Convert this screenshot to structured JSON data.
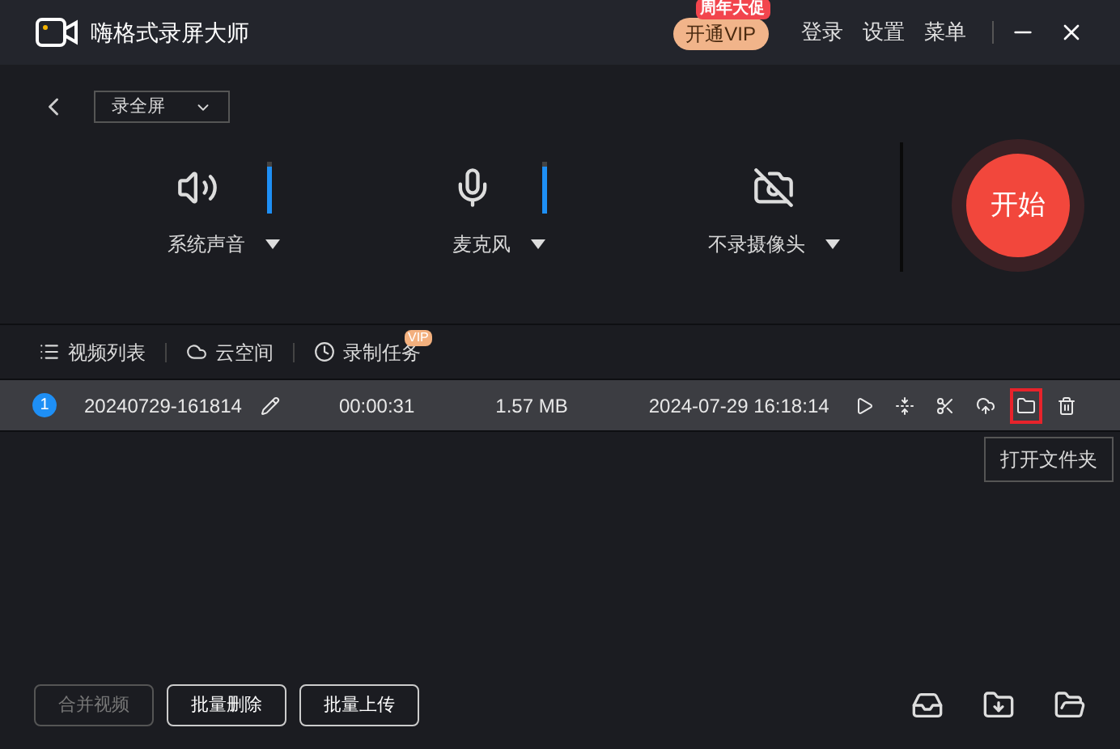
{
  "window": {
    "title": "嗨格式录屏大师",
    "promo_badge": "周年大促",
    "vip_button": "开通VIP",
    "menu": [
      "登录",
      "设置",
      "菜单"
    ]
  },
  "mode_select": {
    "value": "录全屏"
  },
  "sources": [
    {
      "kind": "speaker",
      "label": "系统声音",
      "level": 0.9
    },
    {
      "kind": "mic",
      "label": "麦克风",
      "level": 0.9
    },
    {
      "kind": "camera",
      "label": "不录摄像头"
    }
  ],
  "start_button": "开始",
  "tabs": [
    {
      "kind": "list",
      "label": "视频列表"
    },
    {
      "kind": "cloud",
      "label": "云空间"
    },
    {
      "kind": "clock",
      "label": "录制任务",
      "badge": "VIP"
    }
  ],
  "recordings": [
    {
      "index": "1",
      "name": "20240729-161814",
      "duration": "00:00:31",
      "size": "1.57 MB",
      "date": "2024-07-29 16:18:14",
      "actions": [
        {
          "kind": "play",
          "highlighted": false
        },
        {
          "kind": "compress",
          "highlighted": false
        },
        {
          "kind": "cut",
          "highlighted": false
        },
        {
          "kind": "upload",
          "highlighted": false
        },
        {
          "kind": "folder",
          "highlighted": true
        },
        {
          "kind": "delete",
          "highlighted": false
        }
      ]
    }
  ],
  "tooltip": "打开文件夹",
  "bottom_buttons": [
    {
      "label": "合并视频",
      "disabled": true
    },
    {
      "label": "批量删除",
      "disabled": false
    },
    {
      "label": "批量上传",
      "disabled": false
    }
  ],
  "bottom_icons": [
    {
      "kind": "inbox"
    },
    {
      "kind": "import"
    },
    {
      "kind": "folder"
    }
  ]
}
